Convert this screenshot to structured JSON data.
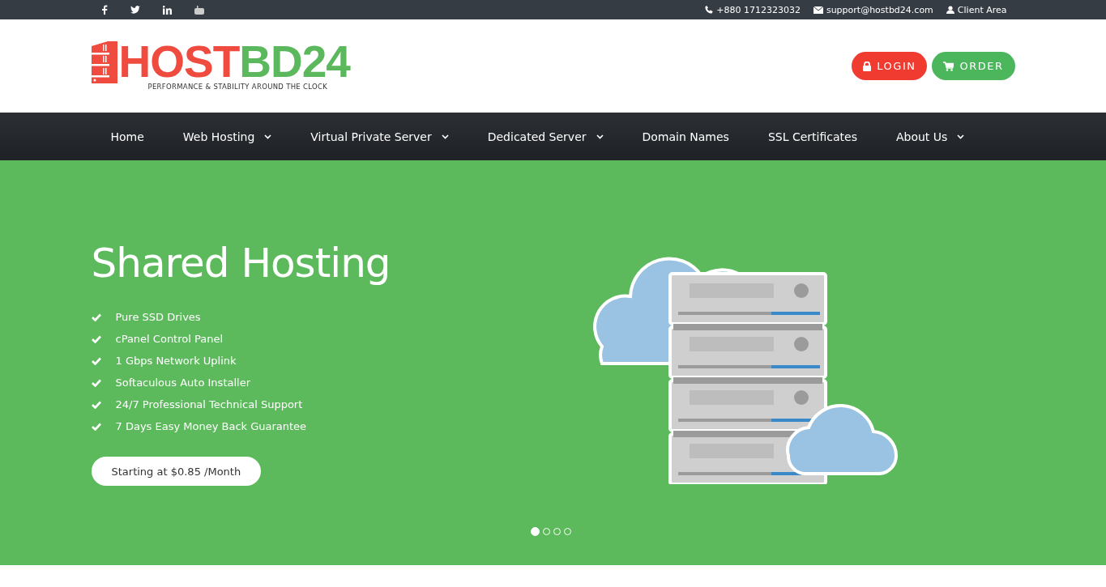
{
  "top_bar": {
    "social": [
      {
        "kind": "facebook"
      },
      {
        "kind": "twitter"
      },
      {
        "kind": "linkedin"
      },
      {
        "kind": "youtube"
      }
    ],
    "contacts": [
      {
        "kind": "phone",
        "text": "+880 1712323032"
      },
      {
        "kind": "email",
        "text": "support@hostbd24.com"
      },
      {
        "kind": "user",
        "text": "Client Area"
      }
    ]
  },
  "header": {
    "logo": {
      "part_1": "HOST",
      "part_2": "BD24",
      "tagline": "PERFORMANCE & STABILITY AROUND THE CLOCK"
    },
    "buttons": [
      {
        "kind": "login",
        "label": "LOGIN"
      },
      {
        "kind": "order",
        "label": "ORDER"
      }
    ]
  },
  "nav": [
    {
      "label": "Home",
      "dropdown": false
    },
    {
      "label": "Web Hosting",
      "dropdown": true
    },
    {
      "label": "Virtual Private Server",
      "dropdown": true
    },
    {
      "label": "Dedicated Server",
      "dropdown": true
    },
    {
      "label": "Domain Names",
      "dropdown": false
    },
    {
      "label": "SSL Certificates",
      "dropdown": false
    },
    {
      "label": "About Us",
      "dropdown": true
    }
  ],
  "hero": {
    "title": "Shared Hosting",
    "features": [
      "Pure SSD Drives",
      "cPanel Control Panel",
      "1 Gbps Network Uplink",
      "Softaculous Auto Installer",
      "24/7 Professional Technical Support",
      "7 Days Easy Money Back Guarantee"
    ],
    "cta": "Starting at $0.85 /Month",
    "slides": [
      {
        "selected": true
      },
      {
        "selected": false
      },
      {
        "selected": false
      },
      {
        "selected": false
      }
    ]
  }
}
